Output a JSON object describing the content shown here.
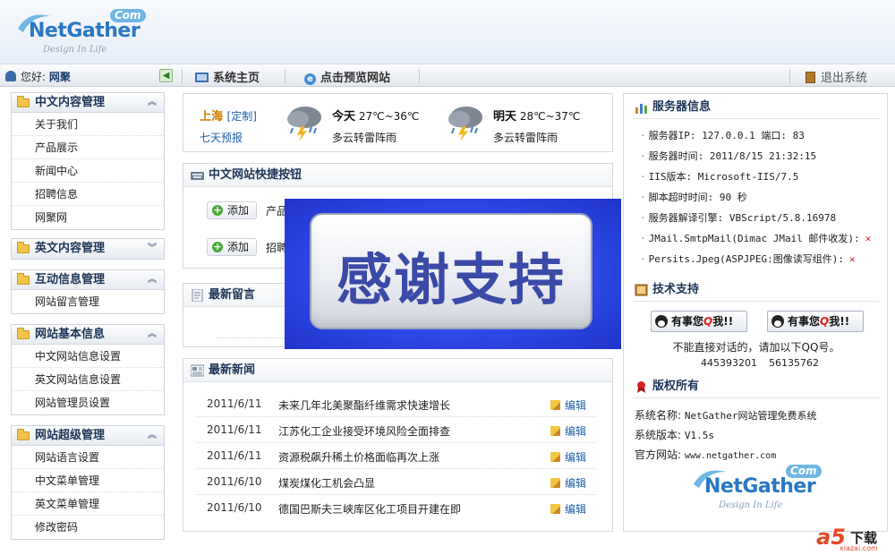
{
  "brand": {
    "com": "Com",
    "name": "NetGather",
    "slogan": "Design In Life"
  },
  "topbar": {
    "greeting_prefix": "您好:",
    "username": "网聚",
    "nav_home": "系统主页",
    "nav_preview": "点击预览网站",
    "logout": "退出系统"
  },
  "sidebar": {
    "groups": [
      {
        "title": "中文内容管理",
        "items": [
          "关于我们",
          "产品展示",
          "新闻中心",
          "招聘信息",
          "网聚网"
        ]
      },
      {
        "title": "英文内容管理",
        "items": []
      },
      {
        "title": "互动信息管理",
        "items": [
          "网站留言管理"
        ]
      },
      {
        "title": "网站基本信息",
        "items": [
          "中文网站信息设置",
          "英文网站信息设置",
          "网站管理员设置"
        ]
      },
      {
        "title": "网站超级管理",
        "items": [
          "网站语言设置",
          "中文菜单管理",
          "英文菜单管理",
          "修改密码"
        ]
      }
    ]
  },
  "weather": {
    "city": "上海",
    "custom": "[定制]",
    "forecast_link": "七天预报",
    "today": {
      "label": "今天",
      "temp": "27℃~36℃",
      "desc": "多云转雷阵雨"
    },
    "tomorrow": {
      "label": "明天",
      "temp": "28℃~37℃",
      "desc": "多云转雷阵雨"
    }
  },
  "quick": {
    "title": "中文网站快捷按钮",
    "buttons": [
      {
        "label": "添加",
        "target": "产品"
      },
      {
        "label": "添加",
        "target": "招聘"
      }
    ]
  },
  "messages": {
    "title": "最新留言"
  },
  "news": {
    "title": "最新新闻",
    "edit_label": "编辑",
    "rows": [
      {
        "date": "2011/6/11",
        "title": "未来几年北美聚酯纤维需求快速增长"
      },
      {
        "date": "2011/6/11",
        "title": "江苏化工企业接受环境风险全面排查"
      },
      {
        "date": "2011/6/11",
        "title": "资源税飙升稀土价格面临再次上涨"
      },
      {
        "date": "2011/6/10",
        "title": "煤炭煤化工机会凸显"
      },
      {
        "date": "2011/6/10",
        "title": "德国巴斯夫三峡库区化工项目开建在即"
      }
    ]
  },
  "overlay": {
    "text": "感谢支持"
  },
  "server": {
    "title": "服务器信息",
    "rows": [
      {
        "text": "服务器IP: 127.0.0.1  端口: 83",
        "x": false
      },
      {
        "text": "服务器时间: 2011/8/15 21:32:15",
        "x": false
      },
      {
        "text": "IIS版本: Microsoft-IIS/7.5",
        "x": false
      },
      {
        "text": "脚本超时时间: 90 秒",
        "x": false
      },
      {
        "text": "服务器解译引擎: VBScript/5.8.16978",
        "x": false
      },
      {
        "text": "JMail.SmtpMail(Dimac JMail 邮件收发):",
        "x": true
      },
      {
        "text": "Persits.Jpeg(ASPJPEG:图像读写组件):",
        "x": true
      }
    ],
    "x_mark": "✕"
  },
  "support": {
    "title": "技术支持",
    "qq_button_pre": "有事您",
    "qq_button_q": "Q",
    "qq_button_post": "我!!",
    "note": "不能直接对话的，请加以下QQ号。",
    "qq_numbers": [
      "445393201",
      "56135762"
    ]
  },
  "copyright": {
    "title": "版权所有",
    "system_name_label": "系统名称:",
    "system_name": "NetGather网站管理免费系统",
    "version_label": "系统版本:",
    "version": "V1.5s",
    "site_label": "官方网站:",
    "site": "www.netgather.com"
  },
  "watermark": {
    "logo": "a5",
    "text": "下载",
    "url": "xiazai.com"
  }
}
